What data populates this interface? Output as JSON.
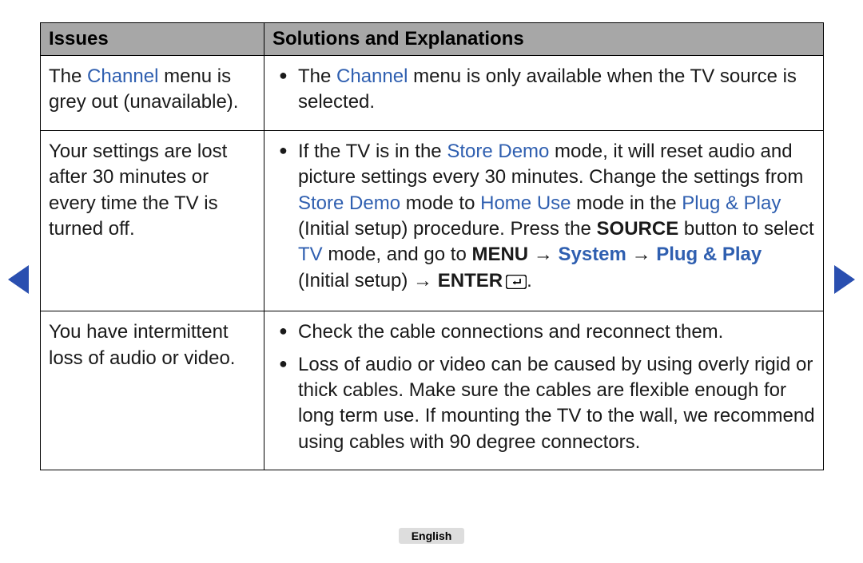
{
  "table": {
    "headers": {
      "issues": "Issues",
      "solutions": "Solutions and Explanations"
    },
    "rows": [
      {
        "issue_pre": "The ",
        "issue_hl": "Channel",
        "issue_post": " menu is grey out (unavailable).",
        "sol_a_pre": "The ",
        "sol_a_hl": "Channel",
        "sol_a_post": " menu is only available when the TV source is selected."
      },
      {
        "issue": "Your settings are lost after 30 minutes or every time the TV is turned off.",
        "sol_a_1": "If the TV is in the ",
        "sol_a_2": "Store Demo",
        "sol_a_3": " mode, it will reset audio and picture settings every 30 minutes. Change the settings from ",
        "sol_a_4": "Store Demo",
        "sol_a_5": " mode to ",
        "sol_a_6": "Home Use",
        "sol_a_7": " mode in the ",
        "sol_a_8": "Plug & Play",
        "sol_a_9": " (Initial setup) procedure. Press the ",
        "sol_a_10": "SOURCE",
        "sol_a_11": " button to select ",
        "sol_a_12": "TV",
        "sol_a_13": " mode, and go to ",
        "sol_a_14": "MENU",
        "sol_a_15": " → ",
        "sol_a_16": "System",
        "sol_a_17": " → ",
        "sol_a_18": "Plug & Play",
        "sol_a_19": " (Initial setup) → ",
        "sol_a_20": "ENTER",
        "sol_a_21": "."
      },
      {
        "issue": "You have intermittent loss of audio or video.",
        "sol_a": "Check the cable connections and reconnect them.",
        "sol_b": "Loss of audio or video can be caused by using overly rigid or thick cables. Make sure the cables are flexible enough for long term use. If mounting the TV to the wall, we recommend using cables with 90 degree connectors."
      }
    ]
  },
  "footer": {
    "language": "English"
  }
}
